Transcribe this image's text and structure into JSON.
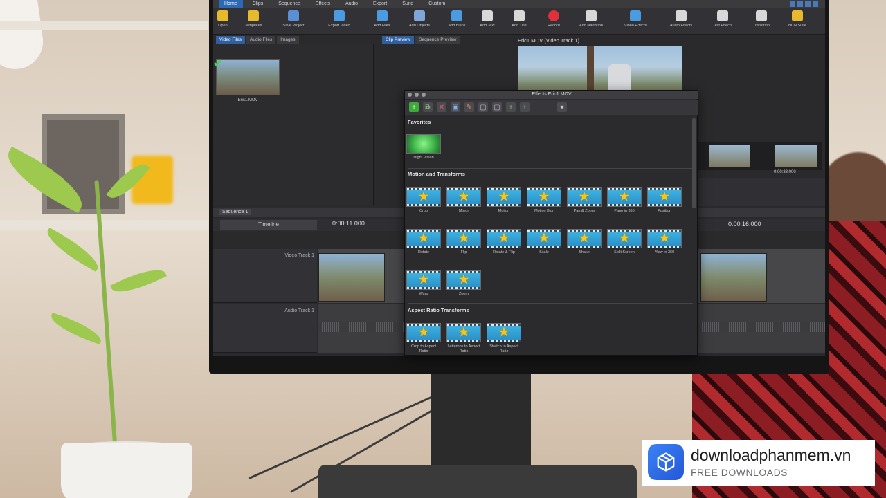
{
  "menu": {
    "tabs": [
      "Home",
      "Clips",
      "Sequence",
      "Effects",
      "Audio",
      "Export",
      "Suite",
      "Custom"
    ]
  },
  "toolbar": {
    "items": [
      {
        "label": "Open",
        "color": "#e8b92a"
      },
      {
        "label": "Templates",
        "color": "#e8b92a"
      },
      {
        "label": "Save Project",
        "color": "#5a8fd6"
      },
      {
        "label": "Export Video",
        "color": "#4b9be0"
      },
      {
        "label": "Add Files",
        "color": "#4b9be0"
      },
      {
        "label": "Add Objects",
        "color": "#7fa6d8"
      },
      {
        "label": "Add Blank",
        "color": "#4b9be0"
      },
      {
        "label": "Add Text",
        "color": "#d8d8d8"
      },
      {
        "label": "Add Title",
        "color": "#d8d8d8"
      },
      {
        "label": "Record",
        "color": "#e0303a"
      },
      {
        "label": "Add Narration",
        "color": "#d8d8d8"
      },
      {
        "label": "Video Effects",
        "color": "#4b9be0"
      },
      {
        "label": "Audio Effects",
        "color": "#d8d8d8"
      },
      {
        "label": "Text Effects",
        "color": "#d8d8d8"
      },
      {
        "label": "Transition",
        "color": "#d8d8d8"
      },
      {
        "label": "NCH Suite",
        "color": "#e8b92a"
      }
    ]
  },
  "media_bin": {
    "tabs": [
      "Video Files",
      "Audio Files",
      "Images"
    ],
    "clip_name": "Eric1.MOV"
  },
  "preview": {
    "tabs": [
      "Clip Preview",
      "Sequence Preview"
    ],
    "title": "Eric1.MOV (Video Track 1)",
    "film_timecode": "0:00:33.000"
  },
  "sequence": {
    "tab": "Sequence 1",
    "view": "Timeline",
    "timecode_left": "0:00:11.000",
    "timecode_right": "0:00:16.000",
    "tracks": [
      "Video Track 1",
      "Audio Track 1"
    ]
  },
  "effects_dialog": {
    "title": "Effects Eric1.MOV",
    "favorites_title": "Favorites",
    "favorites": [
      "Night Vision"
    ],
    "motion_title": "Motion and Transforms",
    "motion": [
      "Crop",
      "Mirror",
      "Motion",
      "Motion Blur",
      "Pan & Zoom",
      "Pano in 360",
      "Position",
      "Rotate",
      "Flip",
      "Rotate & Flip",
      "Scale",
      "Shake",
      "Split Screen",
      "View in 360",
      "Warp",
      "Zoom"
    ],
    "aspect_title": "Aspect Ratio Transforms",
    "aspect": [
      "Crop to Aspect Ratio",
      "Letterbox to Aspect Ratio",
      "Stretch to Aspect Ratio"
    ]
  },
  "badge": {
    "name": "downloadphanmem.vn",
    "sub": "FREE DOWNLOADS"
  }
}
